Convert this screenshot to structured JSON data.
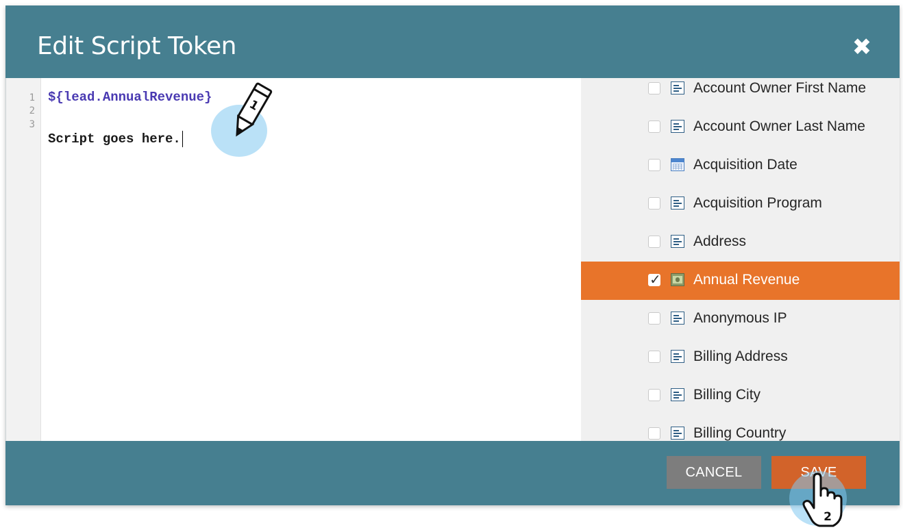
{
  "dialog": {
    "title": "Edit Script Token",
    "close_symbol": "✖"
  },
  "editor": {
    "line_numbers": [
      "1",
      "2",
      "3"
    ],
    "lines": [
      "${lead.AnnualRevenue}",
      "",
      "Script goes here."
    ]
  },
  "fields": [
    {
      "label": "Account Owner First Name",
      "icon": "text-field-icon",
      "checked": false,
      "selected": false
    },
    {
      "label": "Account Owner Last Name",
      "icon": "text-field-icon",
      "checked": false,
      "selected": false
    },
    {
      "label": "Acquisition Date",
      "icon": "calendar-icon",
      "checked": false,
      "selected": false
    },
    {
      "label": "Acquisition Program",
      "icon": "text-field-icon",
      "checked": false,
      "selected": false
    },
    {
      "label": "Address",
      "icon": "text-field-icon",
      "checked": false,
      "selected": false
    },
    {
      "label": "Annual Revenue",
      "icon": "currency-icon",
      "checked": true,
      "selected": true
    },
    {
      "label": "Anonymous IP",
      "icon": "text-field-icon",
      "checked": false,
      "selected": false
    },
    {
      "label": "Billing Address",
      "icon": "text-field-icon",
      "checked": false,
      "selected": false
    },
    {
      "label": "Billing City",
      "icon": "text-field-icon",
      "checked": false,
      "selected": false
    },
    {
      "label": "Billing Country",
      "icon": "text-field-icon",
      "checked": false,
      "selected": false
    }
  ],
  "footer": {
    "cancel_label": "CANCEL",
    "save_label": "SAVE"
  },
  "annotations": {
    "step1": "1",
    "step2": "2"
  },
  "colors": {
    "dialog_teal": "#467f90",
    "selected_orange": "#e8742a",
    "save_orange": "#d2632a",
    "cancel_gray": "#7d7d7d",
    "token_purple": "#4a3ab2"
  }
}
